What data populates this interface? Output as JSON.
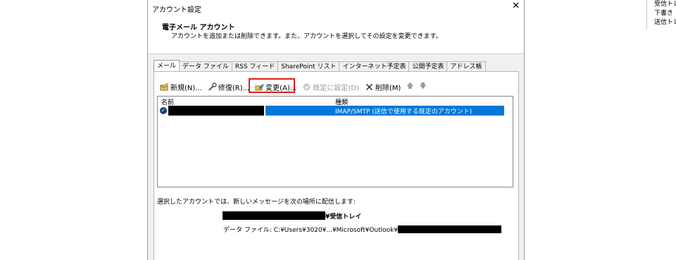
{
  "background_panel": {
    "items": [
      "受信トレイ",
      "下書き",
      "送信トレイ"
    ]
  },
  "dialog": {
    "title": "アカウント設定",
    "close_glyph": "✕",
    "heading": "電子メール アカウント",
    "subheading": "アカウントを追加または削除できます。また、アカウントを選択してその設定を変更できます。"
  },
  "tabs": [
    {
      "label": "メール",
      "active": true
    },
    {
      "label": "データ ファイル"
    },
    {
      "label": "RSS フィード"
    },
    {
      "label": "SharePoint リスト"
    },
    {
      "label": "インターネット予定表"
    },
    {
      "label": "公開予定表"
    },
    {
      "label": "アドレス帳"
    }
  ],
  "toolbar": {
    "new_label": "新規(N)...",
    "repair_label": "修復(R)...",
    "change_label": "変更(A)...",
    "default_label": "既定に設定(D)",
    "remove_label": "削除(M)",
    "up_glyph": "🡅",
    "down_glyph": "🡇"
  },
  "list": {
    "columns": {
      "name": "名前",
      "type": "種類"
    },
    "rows": [
      {
        "type": "IMAP/SMTP (送信で使用する既定のアカウント)",
        "selected": true,
        "name_redacted": true
      }
    ]
  },
  "delivery": {
    "label": "選択したアカウントでは、新しいメッセージを次の場所に配信します:",
    "inbox_suffix": "¥受信トレイ",
    "data_file_prefix": "データ ファイル: C:¥Users¥3020¥...¥Microsoft¥Outlook¥"
  },
  "colors": {
    "selection": "#0078d7",
    "highlight_border": "#e21b1b",
    "dialog_bg": "#f0f0f0"
  }
}
